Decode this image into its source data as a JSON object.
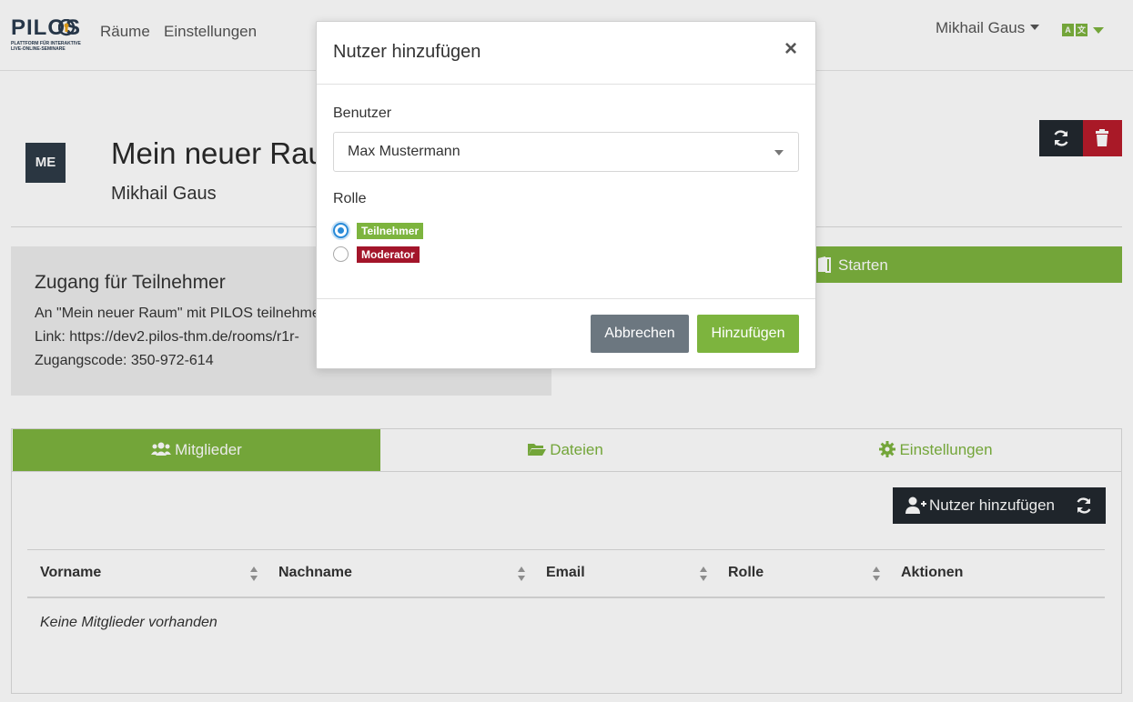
{
  "brand": {
    "title": "PILOS",
    "subtitle": "PLATTFORM FÜR INTERAKTIVE LIVE-ONLINE-SEMINARE"
  },
  "nav": {
    "rooms": "Räume",
    "settings": "Einstellungen",
    "user": "Mikhail Gaus"
  },
  "room": {
    "avatar": "ME",
    "title": "Mein neuer Raum",
    "owner": "Mikhail Gaus"
  },
  "access": {
    "title": "Zugang für Teilnehmer",
    "line1": "An \"Mein neuer Raum\" mit PILOS teilnehmen",
    "line2": "Link: https://dev2.pilos-thm.de/rooms/r1r-",
    "line3": "Zugangscode: 350-972-614"
  },
  "start_button": "Starten",
  "tabs": [
    {
      "label": "Mitglieder",
      "icon": "users-icon"
    },
    {
      "label": "Dateien",
      "icon": "folder-open-icon"
    },
    {
      "label": "Einstellungen",
      "icon": "cog-icon"
    }
  ],
  "members": {
    "add_button": "Nutzer hinzufügen",
    "columns": [
      "Vorname",
      "Nachname",
      "Email",
      "Rolle",
      "Aktionen"
    ],
    "empty": "Keine Mitglieder vorhanden"
  },
  "modal": {
    "title": "Nutzer hinzufügen",
    "close": "×",
    "user_label": "Benutzer",
    "user_value": "Max Mustermann",
    "role_label": "Rolle",
    "roles": [
      {
        "label": "Teilnehmer",
        "checked": true,
        "color": "#7db43e"
      },
      {
        "label": "Moderator",
        "checked": false,
        "color": "#a3152a"
      }
    ],
    "cancel": "Abbrechen",
    "submit": "Hinzufügen"
  },
  "colors": {
    "accent": "#7db43e",
    "dark": "#22292f",
    "danger": "#b81c2b",
    "secondary": "#6c7780"
  }
}
